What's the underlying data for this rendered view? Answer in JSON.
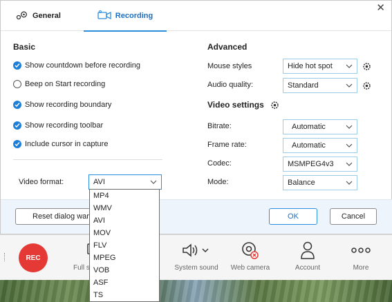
{
  "tabs": {
    "general": "General",
    "recording": "Recording"
  },
  "basic": {
    "title": "Basic",
    "options": [
      {
        "label": "Show countdown before recording",
        "checked": true
      },
      {
        "label": "Beep on Start recording",
        "checked": false
      },
      {
        "label": "Show recording boundary",
        "checked": true
      },
      {
        "label": "Show recording toolbar",
        "checked": true
      },
      {
        "label": "Include cursor in capture",
        "checked": true
      }
    ],
    "video_format": {
      "label": "Video format:",
      "value": "AVI",
      "options": [
        "MP4",
        "WMV",
        "AVI",
        "MOV",
        "FLV",
        "MPEG",
        "VOB",
        "ASF",
        "TS"
      ]
    }
  },
  "advanced": {
    "title": "Advanced",
    "mouse_styles": {
      "label": "Mouse styles",
      "value": "Hide hot spot"
    },
    "audio_quality": {
      "label": "Audio quality:",
      "value": "Standard"
    }
  },
  "video_settings": {
    "title": "Video settings",
    "bitrate": {
      "label": "Bitrate:",
      "value": "Automatic"
    },
    "frame_rate": {
      "label": "Frame rate:",
      "value": "Automatic"
    },
    "codec": {
      "label": "Codec:",
      "value": "MSMPEG4v3"
    },
    "mode": {
      "label": "Mode:",
      "value": "Balance"
    }
  },
  "footer": {
    "reset": "Reset dialog warni",
    "ok": "OK",
    "cancel": "Cancel"
  },
  "toolbar": {
    "rec": "REC",
    "full_screen": "Full s",
    "system_sound": "System sound",
    "web_camera": "Web camera",
    "account": "Account",
    "more": "More"
  },
  "colors": {
    "accent": "#1e7fd8",
    "rec": "#e53935",
    "footer_bg": "#eef4fb"
  }
}
